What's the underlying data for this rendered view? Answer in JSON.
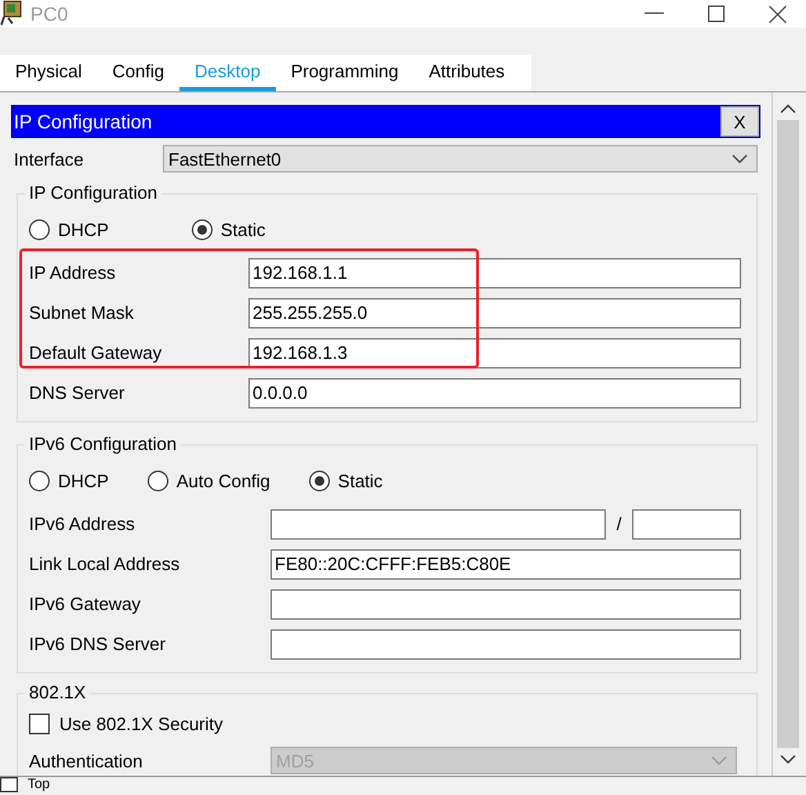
{
  "window": {
    "title": "PC0"
  },
  "tabs": [
    {
      "label": "Physical",
      "selected": false
    },
    {
      "label": "Config",
      "selected": false
    },
    {
      "label": "Desktop",
      "selected": true
    },
    {
      "label": "Programming",
      "selected": false
    },
    {
      "label": "Attributes",
      "selected": false
    }
  ],
  "panel": {
    "title": "IP Configuration",
    "close": "X"
  },
  "interface": {
    "label": "Interface",
    "value": "FastEthernet0"
  },
  "ipv4": {
    "title": "IP Configuration",
    "modes": [
      {
        "label": "DHCP",
        "selected": false
      },
      {
        "label": "Static",
        "selected": true
      }
    ],
    "fields": [
      {
        "label": "IP Address",
        "value": "192.168.1.1",
        "highlighted": true
      },
      {
        "label": "Subnet Mask",
        "value": "255.255.255.0",
        "highlighted": true
      },
      {
        "label": "Default Gateway",
        "value": "192.168.1.3",
        "highlighted": true
      },
      {
        "label": "DNS Server",
        "value": "0.0.0.0",
        "highlighted": false
      }
    ]
  },
  "ipv6": {
    "title": "IPv6 Configuration",
    "modes": [
      {
        "label": "DHCP",
        "selected": false
      },
      {
        "label": "Auto Config",
        "selected": false
      },
      {
        "label": "Static",
        "selected": true
      }
    ],
    "fields": [
      {
        "label": "IPv6 Address",
        "kind": "prefixed",
        "separator": "/"
      },
      {
        "label": "Link Local Address",
        "kind": "plain",
        "value": "FE80::20C:CFFF:FEB5:C80E"
      },
      {
        "label": "IPv6 Gateway",
        "kind": "plain"
      },
      {
        "label": "IPv6 DNS Server",
        "kind": "plain"
      }
    ]
  },
  "dot1x": {
    "title": "802.1X",
    "security": {
      "label": "Use 802.1X Security",
      "checked": false
    },
    "authentication": {
      "label": "Authentication",
      "value": "MD5",
      "disabled": true
    }
  },
  "footer": {
    "top": {
      "label": "Top",
      "checked": false
    }
  }
}
